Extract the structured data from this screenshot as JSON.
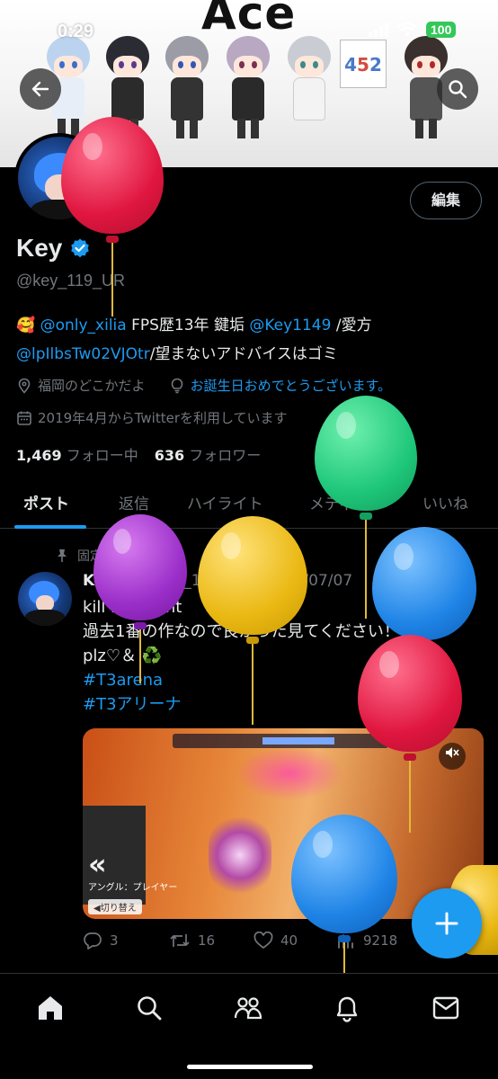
{
  "status_bar": {
    "time": "0:29",
    "battery": "100"
  },
  "banner": {
    "title": "Ace",
    "sign_digits": [
      "4",
      "5",
      "2"
    ]
  },
  "profile": {
    "edit_label": "編集",
    "name": "Key",
    "handle": "@key_119_UR",
    "bio": {
      "emoji": "🥰",
      "mention1": "@only_xilia",
      "text1": " FPS歴13年 鍵垢",
      "mention2": "@Key1149",
      "text2": " /愛方",
      "mention3": "@lpIlbsTw02VJOtr",
      "text3": "/望まないアドバイスはゴミ"
    },
    "location": "福岡のどこかだよ",
    "birthday_text": "お誕生日おめでとうございます。",
    "joined": "2019年4月からTwitterを利用しています",
    "following_count": "1,469",
    "following_label": "フォロー中",
    "followers_count": "636",
    "followers_label": "フォロワー"
  },
  "tabs": [
    "ポスト",
    "返信",
    "ハイライト",
    "メディア",
    "いいね"
  ],
  "post": {
    "pinned_label": "固定",
    "author": "Key",
    "handle_date": "@key_119_UR · 2023/07/07",
    "text_lines": [
      "kill highlight",
      "過去1番の作なので良かった見てください！",
      "plz♡＆ ♻️"
    ],
    "hashtags": [
      "#T3arena",
      "#T3アリーナ"
    ],
    "media_caption": "アングル：プレイヤー",
    "media_button": "◀切り替え",
    "replies": "3",
    "reposts": "16",
    "likes": "40",
    "views": "9218"
  },
  "colors": {
    "accent": "#1d9bf0",
    "background": "#000000",
    "muted": "#71767b"
  },
  "icons": [
    "back-arrow-icon",
    "search-icon",
    "verified-badge-icon",
    "location-pin-icon",
    "lightbulb-icon",
    "calendar-icon",
    "pin-icon",
    "reply-icon",
    "repost-icon",
    "like-icon",
    "views-icon",
    "compose-plus-icon",
    "home-icon",
    "explore-icon",
    "communities-icon",
    "notifications-icon",
    "messages-icon"
  ]
}
